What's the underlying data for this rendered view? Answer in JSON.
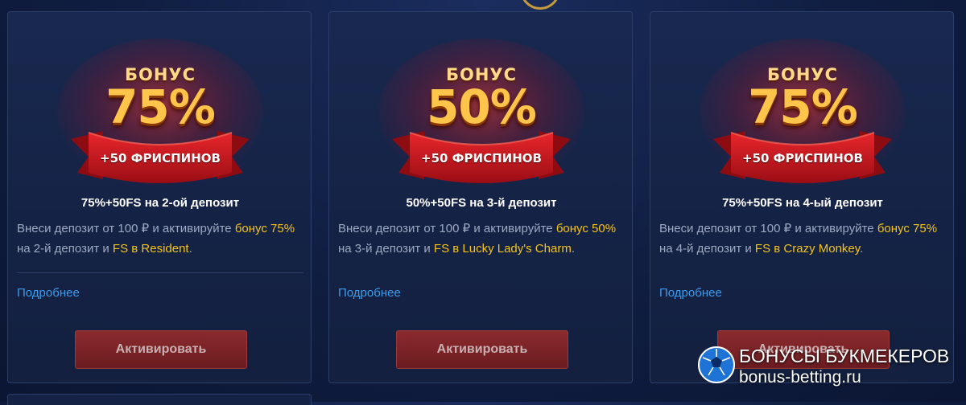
{
  "cards": [
    {
      "banner": {
        "word": "БОНУС",
        "percent": "75%",
        "spins": "+50 ФРИСПИНОВ"
      },
      "title": "75%+50FS на 2-ой депозит",
      "desc": {
        "p1": "Внеси депозит от 100 ₽ и активируйте ",
        "h1": "бонус 75%",
        "p2": " на 2-й депозит и ",
        "h2": "FS в Resident",
        "p3": "."
      },
      "more": "Подробнее",
      "button": "Активировать"
    },
    {
      "banner": {
        "word": "БОНУС",
        "percent": "50%",
        "spins": "+50 ФРИСПИНОВ"
      },
      "title": "50%+50FS на 3-й депозит",
      "desc": {
        "p1": "Внеси депозит от 100 ₽ и активируйте ",
        "h1": "бонус 50%",
        "p2": " на 3-й депозит и ",
        "h2": "FS в Lucky Lady's Charm",
        "p3": "."
      },
      "more": "Подробнее",
      "button": "Активировать"
    },
    {
      "banner": {
        "word": "БОНУС",
        "percent": "75%",
        "spins": "+50 ФРИСПИНОВ"
      },
      "title": "75%+50FS на 4-ый депозит",
      "desc": {
        "p1": "Внеси депозит от 100 ₽ и активируйте ",
        "h1": "бонус 75%",
        "p2": " на 4-й депозит и ",
        "h2": "FS в Crazy Monkey",
        "p3": "."
      },
      "more": "Подробнее",
      "button": "Активировать"
    }
  ],
  "watermark": {
    "line1": "БОНУСЫ БУКМЕКЕРОВ",
    "line2": "bonus-betting.ru"
  },
  "colors": {
    "background": "#0f1d40",
    "card": "#162449",
    "highlight": "#f4c319",
    "link": "#3e9bec",
    "button": "#7a2226",
    "ribbon": "#c8161d",
    "banner_gold": "#ffc44a"
  },
  "icons": [
    "soccer-ball-icon",
    "medallion-icon"
  ]
}
